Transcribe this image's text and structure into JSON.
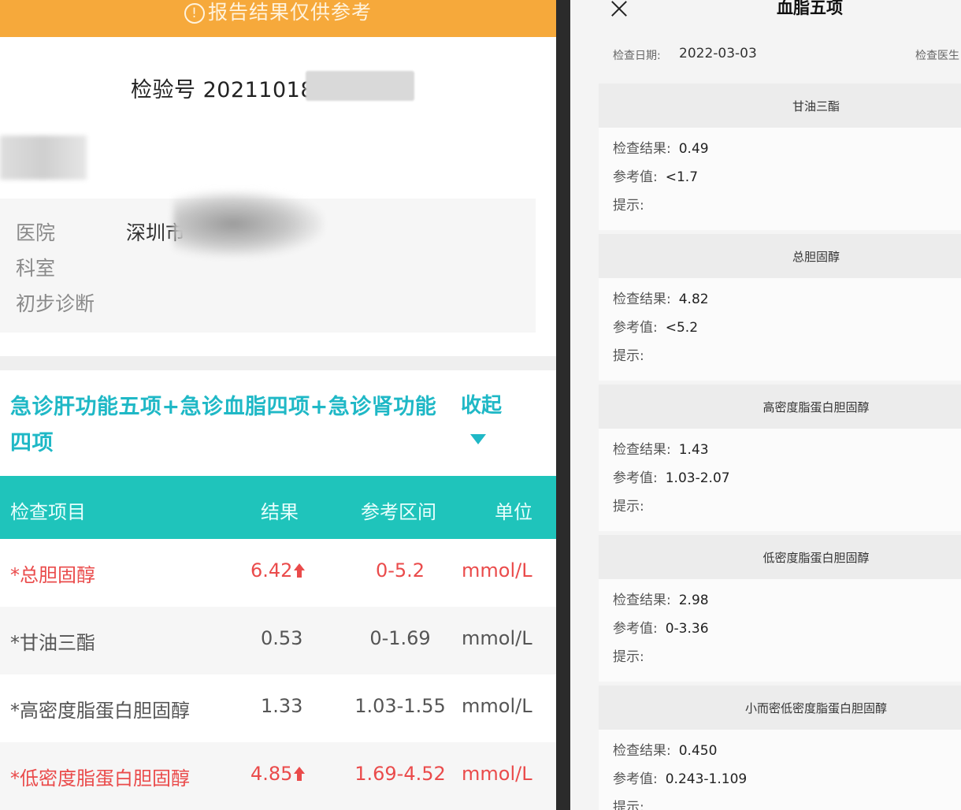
{
  "left": {
    "banner": "报告结果仅供参考",
    "banner_icon": "info-circle-icon",
    "lab_number": "检验号 20211018",
    "info_labels": {
      "hospital": "医院",
      "department": "科室",
      "diagnosis": "初步诊断"
    },
    "hospital_value": "深圳市",
    "group_title": "急诊肝功能五项+急诊血脂四项+急诊肾功能四项",
    "collapse_label": "收起",
    "table": {
      "headers": {
        "item": "检查项目",
        "result": "结果",
        "range": "参考区间",
        "unit": "单位"
      },
      "rows": [
        {
          "name": "*总胆固醇",
          "result": "6.42",
          "range": "0-5.2",
          "unit": "mmol/L",
          "flag": "high"
        },
        {
          "name": "*甘油三酯",
          "result": "0.53",
          "range": "0-1.69",
          "unit": "mmol/L",
          "flag": "normal"
        },
        {
          "name": "*高密度脂蛋白胆固醇",
          "result": "1.33",
          "range": "1.03-1.55",
          "unit": "mmol/L",
          "flag": "normal"
        },
        {
          "name": "*低密度脂蛋白胆固醇",
          "result": "4.85",
          "range": "1.69-4.52",
          "unit": "mmol/L",
          "flag": "high"
        }
      ]
    },
    "colors": {
      "banner": "#f6a93b",
      "accent": "#1fc4bb",
      "high": "#ea4b4b"
    }
  },
  "right": {
    "title": "血脂五项",
    "date_label": "检查日期:",
    "date_value": "2022-03-03",
    "doctor_label": "检查医生",
    "labels": {
      "result": "检查结果:",
      "reference": "参考值:",
      "hint": "提示:"
    },
    "sections": [
      {
        "name": "甘油三酯",
        "result": "0.49",
        "reference": "<1.7"
      },
      {
        "name": "总胆固醇",
        "result": "4.82",
        "reference": "<5.2"
      },
      {
        "name": "高密度脂蛋白胆固醇",
        "result": "1.43",
        "reference": "1.03-2.07"
      },
      {
        "name": "低密度脂蛋白胆固醇",
        "result": "2.98",
        "reference": "0-3.36"
      },
      {
        "name": "小而密低密度脂蛋白胆固醇",
        "result": "0.450",
        "reference": "0.243-1.109"
      }
    ]
  }
}
